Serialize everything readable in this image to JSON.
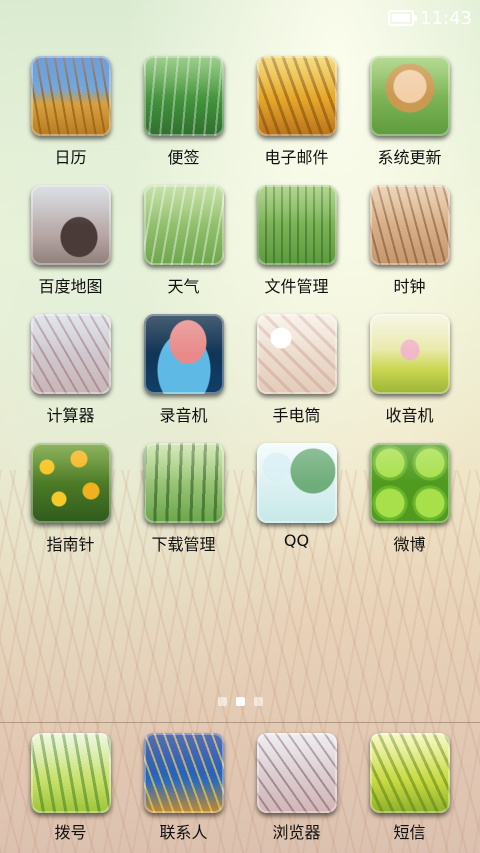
{
  "status_bar": {
    "time": "11:43",
    "battery_icon": "battery-icon"
  },
  "apps": [
    {
      "id": "calendar",
      "label": "日历",
      "icon": "calendar-icon",
      "art": "wheat-sky"
    },
    {
      "id": "notes",
      "label": "便签",
      "icon": "notes-icon",
      "art": "green-wheat"
    },
    {
      "id": "email",
      "label": "电子邮件",
      "icon": "email-icon",
      "art": "golden"
    },
    {
      "id": "system-update",
      "label": "系统更新",
      "icon": "system-update-icon",
      "art": "girl"
    },
    {
      "id": "baidu-map",
      "label": "百度地图",
      "icon": "map-icon",
      "art": "street"
    },
    {
      "id": "weather",
      "label": "天气",
      "icon": "weather-icon",
      "art": "pale-green"
    },
    {
      "id": "file-manager",
      "label": "文件管理",
      "icon": "file-manager-icon",
      "art": "mid-green"
    },
    {
      "id": "clock",
      "label": "时钟",
      "icon": "clock-icon",
      "art": "brown-wheat"
    },
    {
      "id": "calculator",
      "label": "计算器",
      "icon": "calculator-icon",
      "art": "lavender-wheat"
    },
    {
      "id": "recorder",
      "label": "录音机",
      "icon": "recorder-icon",
      "art": "blue-heart"
    },
    {
      "id": "flashlight",
      "label": "手电筒",
      "icon": "flashlight-icon",
      "art": "blossom"
    },
    {
      "id": "radio",
      "label": "收音机",
      "icon": "radio-icon",
      "art": "field-girl"
    },
    {
      "id": "compass",
      "label": "指南针",
      "icon": "compass-icon",
      "art": "flowers"
    },
    {
      "id": "download-manager",
      "label": "下载管理",
      "icon": "download-icon",
      "art": "dl-wheat"
    },
    {
      "id": "qq",
      "label": "QQ",
      "icon": "qq-icon",
      "art": "lotus"
    },
    {
      "id": "weibo",
      "label": "微博",
      "icon": "weibo-icon",
      "art": "limes"
    }
  ],
  "page_indicator": {
    "count": 3,
    "active_index": 1
  },
  "dock": [
    {
      "id": "dialer",
      "label": "拨号",
      "icon": "phone-icon",
      "art": "dock-dial"
    },
    {
      "id": "contacts",
      "label": "联系人",
      "icon": "contacts-icon",
      "art": "dock-contacts"
    },
    {
      "id": "browser",
      "label": "浏览器",
      "icon": "browser-icon",
      "art": "dock-browser"
    },
    {
      "id": "sms",
      "label": "短信",
      "icon": "sms-icon",
      "art": "dock-sms"
    }
  ]
}
